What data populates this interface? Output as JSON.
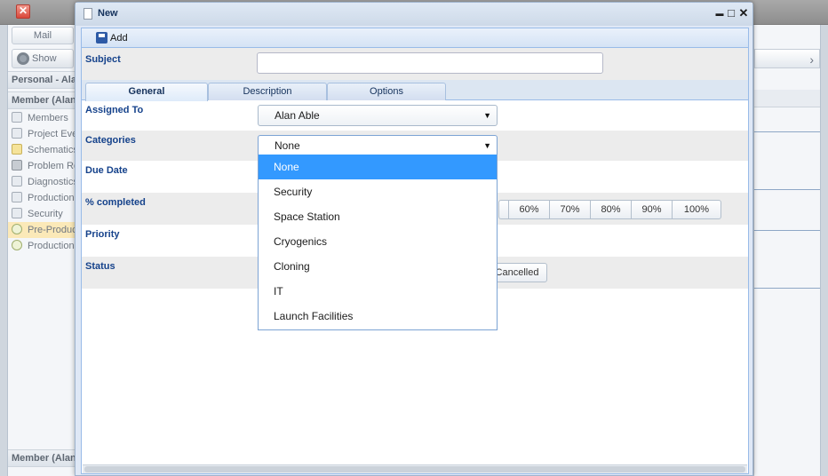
{
  "background": {
    "mail_label": "Mail",
    "show_label": "Show",
    "section_personal": "Personal - Alan",
    "section_member": "Member (Alan Able)",
    "section_member_bottom": "Member (Alan Able)",
    "list": [
      "Members",
      "Project Events",
      "Schematics",
      "Problem Reports",
      "Diagnostics",
      "Production",
      "Security",
      "Pre-Production",
      "Production"
    ],
    "list_icons": [
      "members-icon",
      "calendar-icon",
      "folder-icon",
      "bolt-icon",
      "paper-icon",
      "paper-icon",
      "paper-icon",
      "task-icon",
      "task-icon"
    ],
    "selected_index": 7
  },
  "window": {
    "title": "New",
    "minimize_glyph": "▬",
    "maximize_glyph": "□",
    "close_glyph": "✕"
  },
  "toolbar": {
    "add_label": "Add"
  },
  "form": {
    "subject_label": "Subject",
    "subject_value": "",
    "tabs": [
      "General",
      "Description",
      "Options"
    ],
    "active_tab": 0,
    "assigned_to_label": "Assigned To",
    "assigned_to_value": "Alan Able",
    "categories_label": "Categories",
    "categories_value": "None",
    "due_date_label": "Due Date",
    "percent_label": "% completed",
    "percent_options": [
      "",
      "60%",
      "70%",
      "80%",
      "90%",
      "100%"
    ],
    "priority_label": "Priority",
    "status_label": "Status",
    "status_visible_option": "Cancelled"
  },
  "dropdown": {
    "options": [
      "None",
      "Security",
      "Space Station",
      "Cryogenics",
      "Cloning",
      "IT",
      "Launch Facilities"
    ],
    "selected_index": 0
  },
  "colors": {
    "accent_selected": "#3399ff",
    "label_blue": "#15428b",
    "window_border": "#99bbe8"
  }
}
